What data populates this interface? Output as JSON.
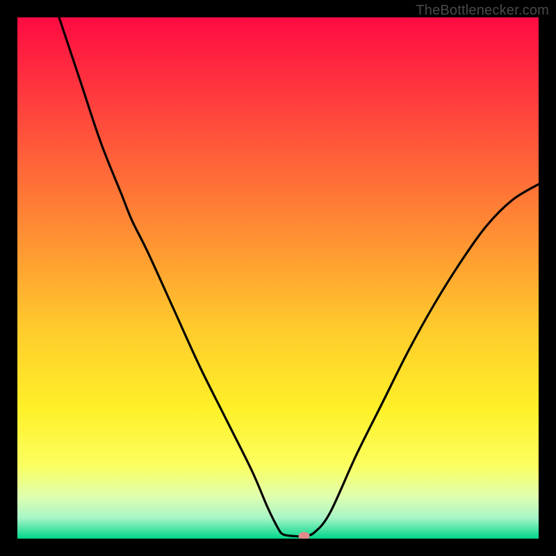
{
  "watermark": "TheBottlenecker.com",
  "chart_data": {
    "type": "line",
    "title": "",
    "xlabel": "",
    "ylabel": "",
    "xlim": [
      0,
      100
    ],
    "ylim": [
      0,
      100
    ],
    "grid": false,
    "legend": false,
    "curve": [
      {
        "x": 8,
        "y": 100
      },
      {
        "x": 12,
        "y": 88
      },
      {
        "x": 16,
        "y": 76
      },
      {
        "x": 20,
        "y": 66
      },
      {
        "x": 22,
        "y": 61
      },
      {
        "x": 25,
        "y": 55
      },
      {
        "x": 30,
        "y": 44
      },
      {
        "x": 35,
        "y": 33
      },
      {
        "x": 40,
        "y": 23
      },
      {
        "x": 45,
        "y": 13
      },
      {
        "x": 48,
        "y": 6
      },
      {
        "x": 50,
        "y": 2
      },
      {
        "x": 51,
        "y": 0.8
      },
      {
        "x": 53,
        "y": 0.5
      },
      {
        "x": 55,
        "y": 0.5
      },
      {
        "x": 57,
        "y": 1.2
      },
      {
        "x": 60,
        "y": 5
      },
      {
        "x": 65,
        "y": 16
      },
      {
        "x": 70,
        "y": 26
      },
      {
        "x": 75,
        "y": 36
      },
      {
        "x": 80,
        "y": 45
      },
      {
        "x": 85,
        "y": 53
      },
      {
        "x": 90,
        "y": 60
      },
      {
        "x": 95,
        "y": 65
      },
      {
        "x": 100,
        "y": 68
      }
    ],
    "marker": {
      "x": 55,
      "y": 0.5,
      "color": "#e08a8a"
    },
    "background_gradient": {
      "stops": [
        {
          "pos": 0.0,
          "color": "#ff0b42"
        },
        {
          "pos": 0.15,
          "color": "#ff3a3e"
        },
        {
          "pos": 0.3,
          "color": "#ff6a38"
        },
        {
          "pos": 0.45,
          "color": "#ff9a32"
        },
        {
          "pos": 0.6,
          "color": "#ffcc2c"
        },
        {
          "pos": 0.75,
          "color": "#fff028"
        },
        {
          "pos": 0.86,
          "color": "#fbff60"
        },
        {
          "pos": 0.92,
          "color": "#dfffb0"
        },
        {
          "pos": 0.96,
          "color": "#a8f5c8"
        },
        {
          "pos": 1.0,
          "color": "#00d78a"
        }
      ]
    }
  }
}
